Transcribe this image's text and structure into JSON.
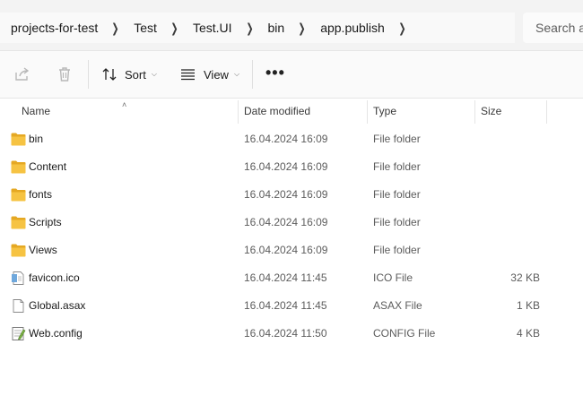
{
  "breadcrumb": [
    "projects-for-test",
    "Test",
    "Test.UI",
    "bin",
    "app.publish"
  ],
  "search": {
    "placeholder": "Search a"
  },
  "toolbar": {
    "sort_label": "Sort",
    "view_label": "View",
    "more_label": "•••"
  },
  "columns": {
    "name": "Name",
    "date": "Date modified",
    "type": "Type",
    "size": "Size"
  },
  "files": [
    {
      "name": "bin",
      "date": "16.04.2024 16:09",
      "type": "File folder",
      "size": "",
      "icon": "folder-icon"
    },
    {
      "name": "Content",
      "date": "16.04.2024 16:09",
      "type": "File folder",
      "size": "",
      "icon": "folder-icon"
    },
    {
      "name": "fonts",
      "date": "16.04.2024 16:09",
      "type": "File folder",
      "size": "",
      "icon": "folder-icon"
    },
    {
      "name": "Scripts",
      "date": "16.04.2024 16:09",
      "type": "File folder",
      "size": "",
      "icon": "folder-icon"
    },
    {
      "name": "Views",
      "date": "16.04.2024 16:09",
      "type": "File folder",
      "size": "",
      "icon": "folder-icon"
    },
    {
      "name": "favicon.ico",
      "date": "16.04.2024 11:45",
      "type": "ICO File",
      "size": "32 KB",
      "icon": "image-file-icon"
    },
    {
      "name": "Global.asax",
      "date": "16.04.2024 11:45",
      "type": "ASAX File",
      "size": "1 KB",
      "icon": "document-file-icon"
    },
    {
      "name": "Web.config",
      "date": "16.04.2024 11:50",
      "type": "CONFIG File",
      "size": "4 KB",
      "icon": "config-file-icon"
    }
  ],
  "colors": {
    "folder": "#f6c342",
    "folder_dark": "#e5a823",
    "accent": "#0067c0"
  }
}
